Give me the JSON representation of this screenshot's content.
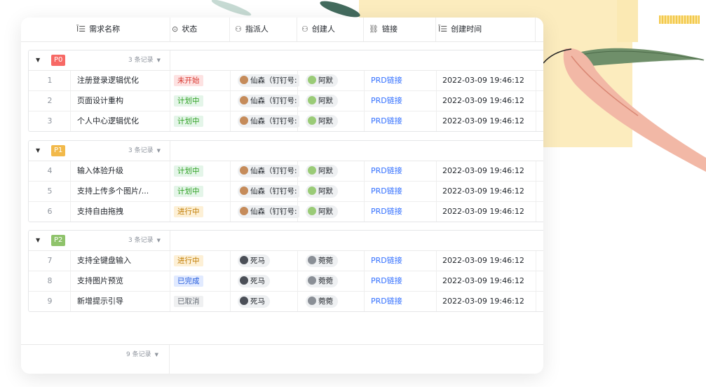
{
  "header": {
    "columns": [
      {
        "icon": "text-field-icon",
        "glyph": "Ī☰",
        "label": "需求名称"
      },
      {
        "icon": "status-icon",
        "glyph": "⊙",
        "label": "状态"
      },
      {
        "icon": "person-icon",
        "glyph": "⚇",
        "label": "指派人"
      },
      {
        "icon": "person-icon",
        "glyph": "⚇",
        "label": "创建人"
      },
      {
        "icon": "link-icon",
        "glyph": "⛓",
        "label": "链接"
      },
      {
        "icon": "text-field-icon",
        "glyph": "Ī☰",
        "label": "创建时间"
      }
    ]
  },
  "status_colors": {
    "未开始": {
      "bg": "#fde2e2",
      "fg": "#d83931"
    },
    "计划中": {
      "bg": "#e4f5e9",
      "fg": "#2ea121"
    },
    "进行中": {
      "bg": "#fdf0d6",
      "fg": "#c07b00"
    },
    "已完成": {
      "bg": "#e1eaff",
      "fg": "#245bdb"
    },
    "已取消": {
      "bg": "#eff0f1",
      "fg": "#646a73"
    }
  },
  "groups": [
    {
      "tag": "P0",
      "tag_color": "#f76965",
      "count_label": "3 条记录",
      "rows": [
        {
          "num": "1",
          "name": "注册登录逻辑优化",
          "status": "未开始",
          "assignee": "仙森（钉钉号:",
          "creator": "阿默",
          "link": "PRD链接",
          "time": "2022-03-09 19:46:12"
        },
        {
          "num": "2",
          "name": "页面设计重构",
          "status": "计划中",
          "assignee": "仙森（钉钉号:",
          "creator": "阿默",
          "link": "PRD链接",
          "time": "2022-03-09 19:46:12"
        },
        {
          "num": "3",
          "name": "个人中心逻辑优化",
          "status": "计划中",
          "assignee": "仙森（钉钉号:",
          "creator": "阿默",
          "link": "PRD链接",
          "time": "2022-03-09 19:46:12"
        }
      ]
    },
    {
      "tag": "P1",
      "tag_color": "#f2b94a",
      "count_label": "3 条记录",
      "rows": [
        {
          "num": "4",
          "name": "输入体验升级",
          "status": "计划中",
          "assignee": "仙森（钉钉号:",
          "creator": "阿默",
          "link": "PRD链接",
          "time": "2022-03-09 19:46:12"
        },
        {
          "num": "5",
          "name": "支持上传多个图片/...",
          "status": "计划中",
          "assignee": "仙森（钉钉号:",
          "creator": "阿默",
          "link": "PRD链接",
          "time": "2022-03-09 19:46:12"
        },
        {
          "num": "6",
          "name": "支持自由拖拽",
          "status": "进行中",
          "assignee": "仙森（钉钉号:",
          "creator": "阿默",
          "link": "PRD链接",
          "time": "2022-03-09 19:46:12"
        }
      ]
    },
    {
      "tag": "P2",
      "tag_color": "#8fc36b",
      "count_label": "3 条记录",
      "rows": [
        {
          "num": "7",
          "name": "支持全键盘输入",
          "status": "进行中",
          "assignee": "死马",
          "creator": "菀菀",
          "link": "PRD链接",
          "time": "2022-03-09 19:46:12"
        },
        {
          "num": "8",
          "name": "支持图片预览",
          "status": "已完成",
          "assignee": "死马",
          "creator": "菀菀",
          "link": "PRD链接",
          "time": "2022-03-09 19:46:12"
        },
        {
          "num": "9",
          "name": "新增提示引导",
          "status": "已取消",
          "assignee": "死马",
          "creator": "菀菀",
          "link": "PRD链接",
          "time": "2022-03-09 19:46:12"
        }
      ]
    }
  ],
  "footer": {
    "count_label": "9 条记录"
  }
}
